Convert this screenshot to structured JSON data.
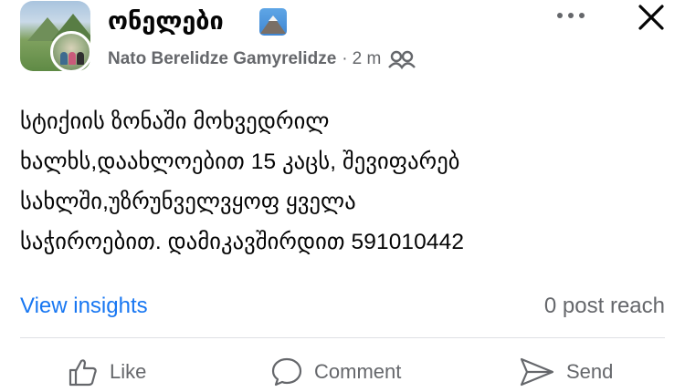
{
  "post": {
    "group_name": "ონელები",
    "author": "Nato Berelidze Gamyrelidze",
    "separator": "·",
    "time": "2 m",
    "text": "სტიქიის ზონაში მოხვედრილ\nხალხს,დაახლოებით 15 კაცს, შევიფარებ\nსახლში,უზრუნველვყოფ ყველა\nსაჭიროებით. დამიკავშირდით 591010442"
  },
  "insights": {
    "link_label": "View insights",
    "reach_label": "0 post reach"
  },
  "actions": {
    "like_label": "Like",
    "comment_label": "Comment",
    "send_label": "Send"
  },
  "icons": {
    "title_emoji": "mountain-emoji",
    "audience": "members-icon",
    "more": "more-options-icon",
    "close": "close-icon",
    "like": "thumbs-up-icon",
    "comment": "comment-bubble-icon",
    "send": "send-arrow-icon"
  },
  "colors": {
    "link": "#1877f2",
    "secondary_text": "#65676b",
    "primary_text": "#050505",
    "divider": "#dfe1e5"
  }
}
